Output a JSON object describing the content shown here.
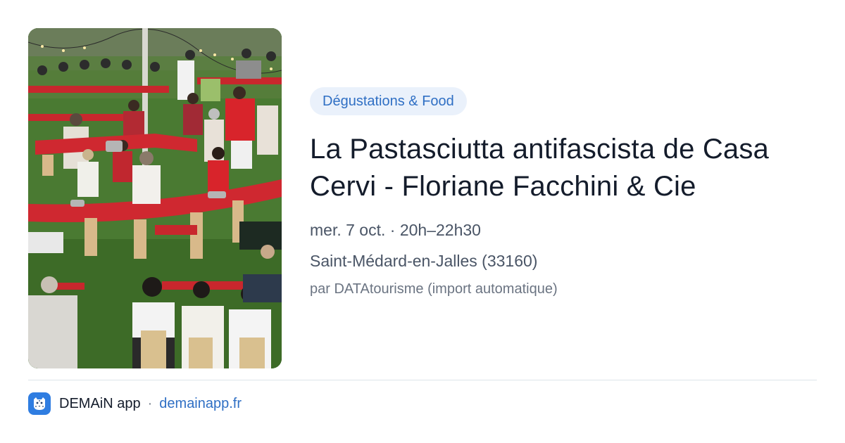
{
  "event": {
    "category": "Dégustations & Food",
    "title": "La Pastasciutta antifascista de Casa Cervi - Floriane Facchini & Cie",
    "when": "mer. 7 oct. · 20h–22h30",
    "where": "Saint-Médard-en-Jalles (33160)",
    "source": "par DATAtourisme (import automatique)",
    "photo_subject": "outdoor communal dinner around red curved tables on grass"
  },
  "footer": {
    "app_name": "DEMAiN app",
    "separator": "·",
    "link": "demainapp.fr",
    "logo_icon": "leopard-face-icon"
  },
  "colors": {
    "accent": "#2f6fc4",
    "pill_bg": "#eaf1fb",
    "logo_bg": "#2f7de1"
  }
}
